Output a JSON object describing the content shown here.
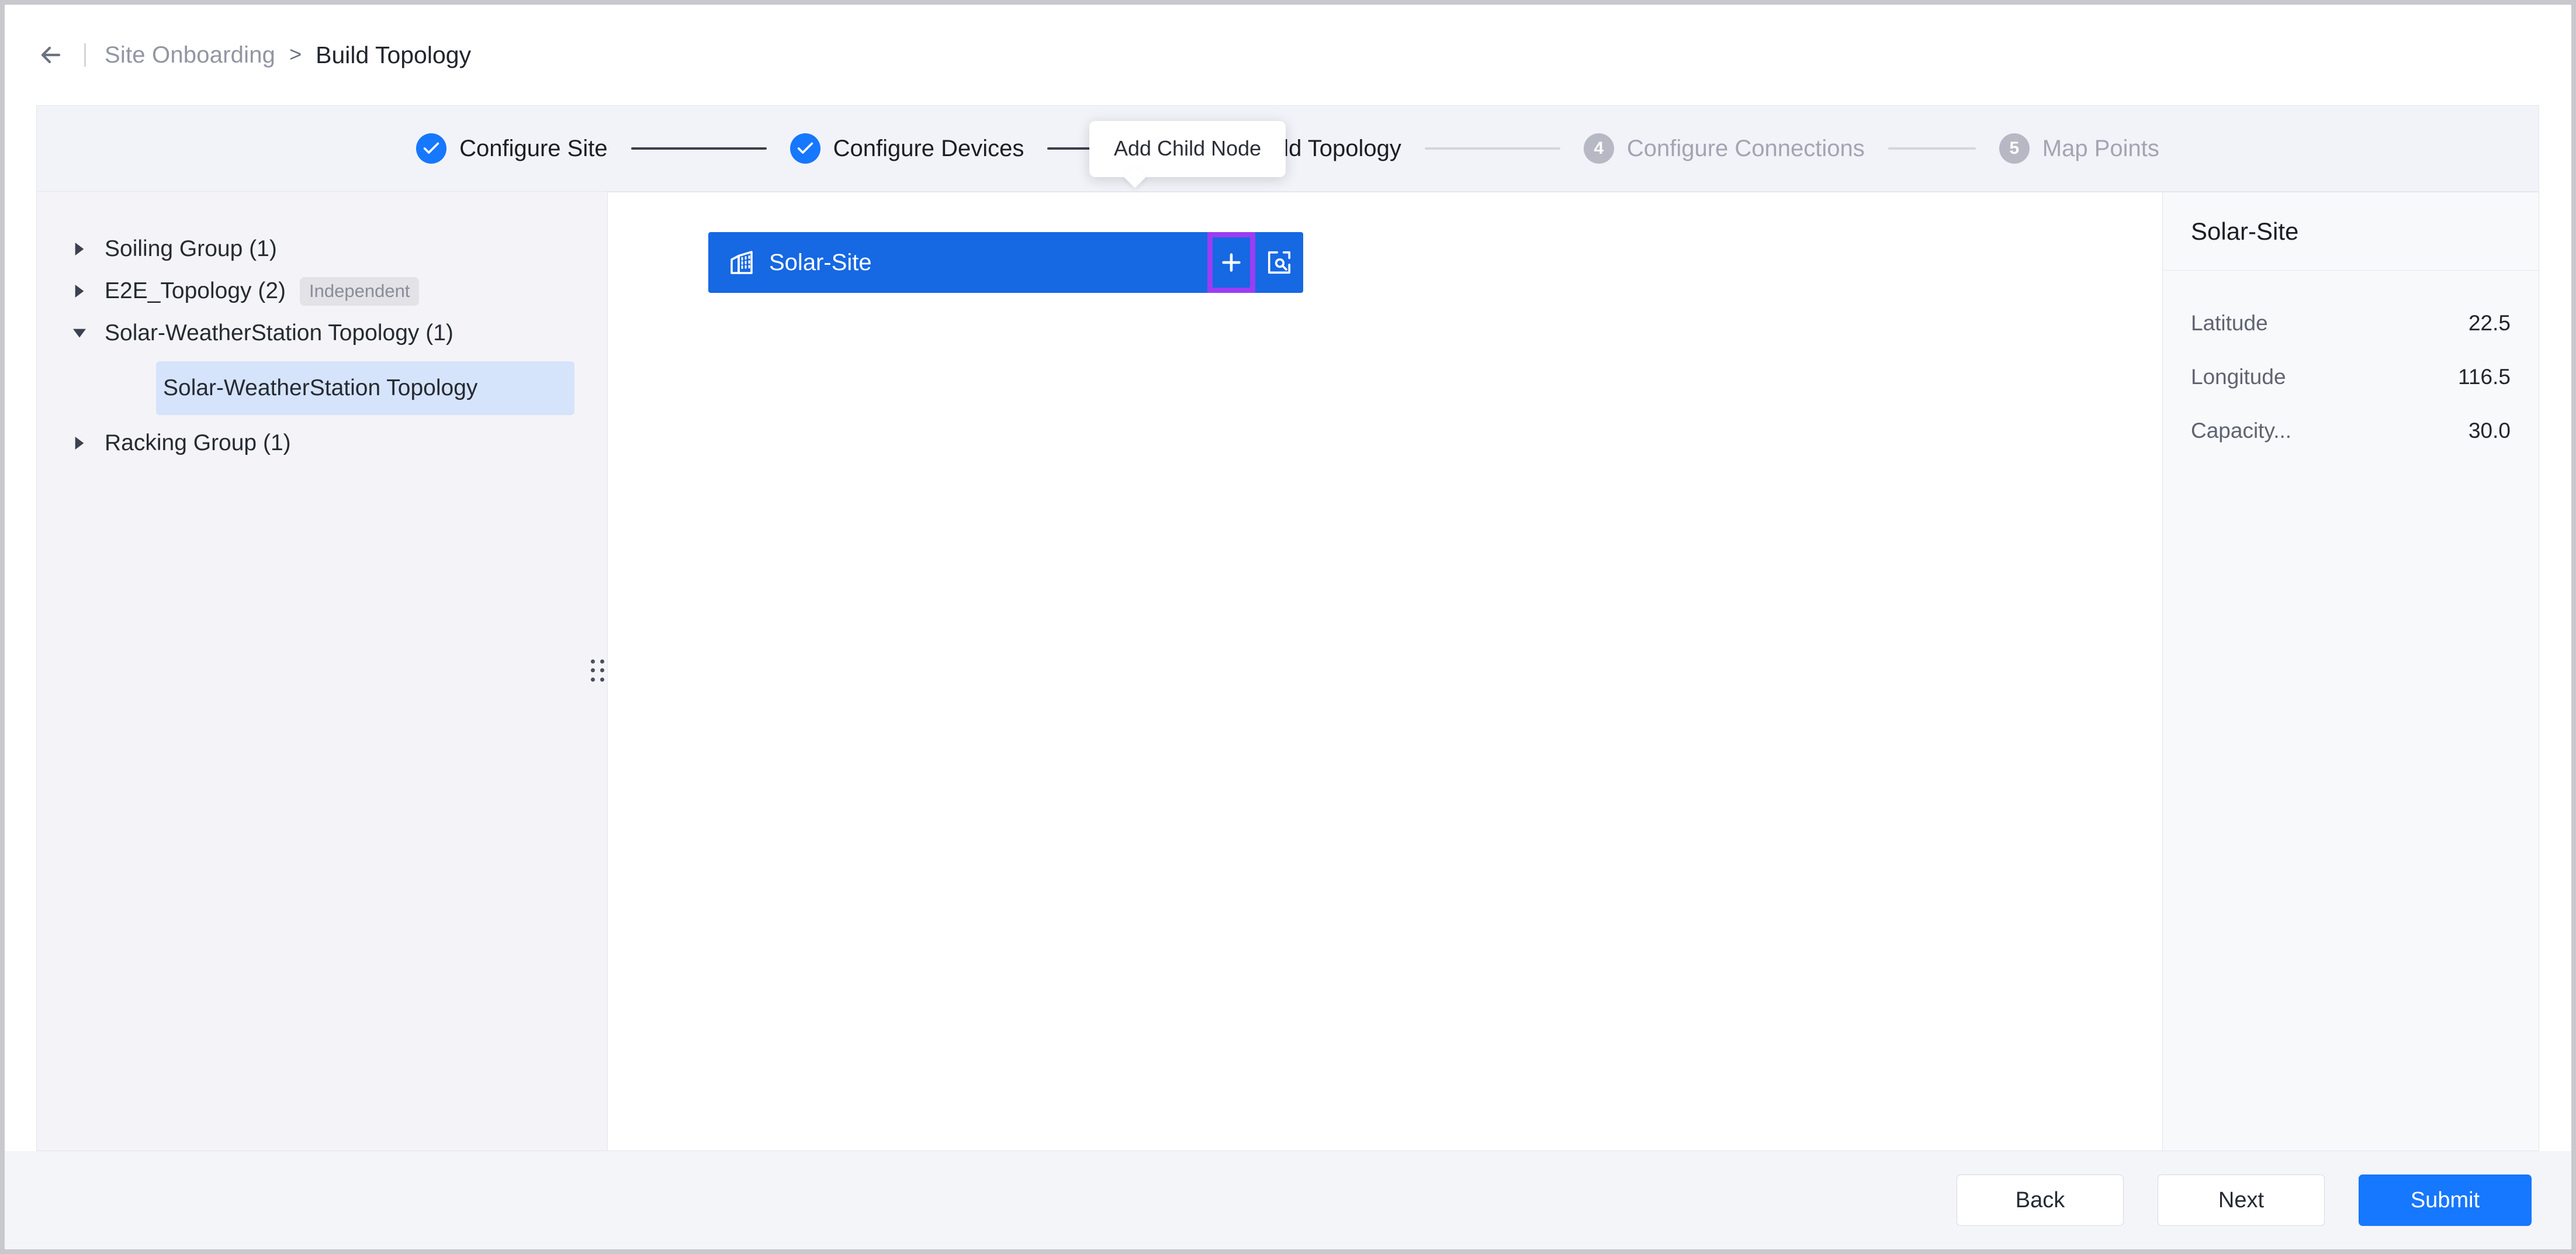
{
  "breadcrumb": {
    "back_icon": "arrow-left-icon",
    "parent": "Site Onboarding",
    "separator": ">",
    "current": "Build Topology"
  },
  "stepper": {
    "steps": [
      {
        "num": "1",
        "label": "Configure Site",
        "state": "done",
        "icon": "check-icon"
      },
      {
        "num": "2",
        "label": "Configure Devices",
        "state": "done",
        "icon": "check-icon"
      },
      {
        "num": "3",
        "label": "Build Topology",
        "state": "active"
      },
      {
        "num": "4",
        "label": "Configure Connections",
        "state": "todo"
      },
      {
        "num": "5",
        "label": "Map Points",
        "state": "todo"
      }
    ]
  },
  "tree": {
    "items": [
      {
        "label": "Soiling Group (1)",
        "expanded": false,
        "badge": ""
      },
      {
        "label": "E2E_Topology (2)",
        "expanded": false,
        "badge": "Independent"
      },
      {
        "label": "Solar-WeatherStation Topology (1)",
        "expanded": true,
        "badge": ""
      },
      {
        "label": "Racking Group (1)",
        "expanded": false,
        "badge": ""
      }
    ],
    "selected_child": "Solar-WeatherStation Topology"
  },
  "canvas": {
    "node": {
      "title": "Solar-Site",
      "icon": "building-icon",
      "add_icon": "plus-icon",
      "inspect_icon": "zoom-square-icon"
    },
    "tooltip": "Add Child Node"
  },
  "detail": {
    "title": "Solar-Site",
    "rows": [
      {
        "key": "Latitude",
        "value": "22.5"
      },
      {
        "key": "Longitude",
        "value": "116.5"
      },
      {
        "key": "Capacity...",
        "value": "30.0"
      }
    ]
  },
  "footer": {
    "back": "Back",
    "next": "Next",
    "submit": "Submit"
  },
  "colors": {
    "accent": "#1677ff",
    "node": "#1668e3",
    "highlight": "#9b3df2",
    "selected_row": "#d6e4fb",
    "panel_bg": "#f4f4f8",
    "muted_text": "#a2a5b2"
  }
}
